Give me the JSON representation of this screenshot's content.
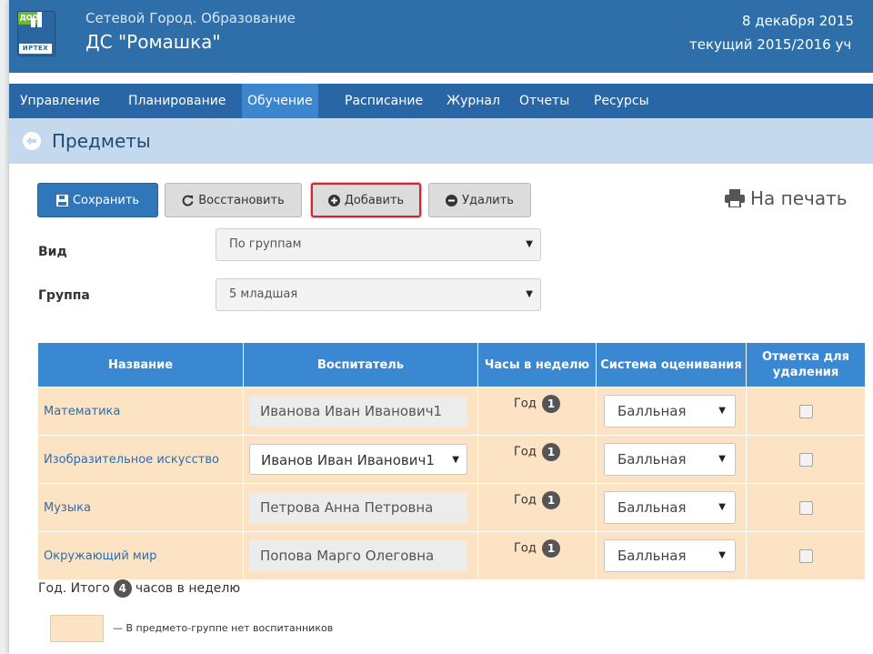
{
  "header": {
    "logo_top": "ДОО",
    "logo_bottom": "ИРТЕХ",
    "app_title": "Сетевой Город. Образование",
    "org_name": "ДС \"Ромашка\"",
    "date": "8 декабря 2015",
    "school_year": "текущий 2015/2016 уч"
  },
  "menu": {
    "items": [
      {
        "label": "Управление"
      },
      {
        "label": "Планирование"
      },
      {
        "label": "Обучение",
        "active": true
      },
      {
        "label": "Расписание"
      },
      {
        "label": "Журнал"
      },
      {
        "label": "Отчеты"
      },
      {
        "label": "Ресурсы"
      }
    ]
  },
  "page": {
    "title": "Предметы"
  },
  "toolbar": {
    "save_label": "Сохранить",
    "restore_label": "Восстановить",
    "add_label": "Добавить",
    "delete_label": "Удалить",
    "print_label": "На печать"
  },
  "filters": {
    "view_label": "Вид",
    "view_value": "По группам",
    "group_label": "Группа",
    "group_value": "5 младшая"
  },
  "table": {
    "headers": [
      "Название",
      "Воспитатель",
      "Часы в неделю",
      "Система оценивания",
      "Отметка для удаления"
    ],
    "rows": [
      {
        "subject": "Математика",
        "teacher": "Иванова Иван Иванович1",
        "teacher_is_select": false,
        "period": "Год",
        "hours": "1",
        "grading": "Балльная",
        "mark": false
      },
      {
        "subject": "Изобразительное искусство",
        "teacher": "Иванов Иван Иванович1",
        "teacher_is_select": true,
        "period": "Год",
        "hours": "1",
        "grading": "Балльная",
        "mark": false
      },
      {
        "subject": "Музыка",
        "teacher": "Петрова Анна Петровна",
        "teacher_is_select": false,
        "period": "Год",
        "hours": "1",
        "grading": "Балльная",
        "mark": false
      },
      {
        "subject": "Окружающий мир",
        "teacher": "Попова Марго Олеговна",
        "teacher_is_select": false,
        "period": "Год",
        "hours": "1",
        "grading": "Балльная",
        "mark": false
      }
    ]
  },
  "summary": {
    "prefix": "Год. Итого",
    "total": "4",
    "suffix": "часов в неделю"
  },
  "legend": {
    "text": "— В предмето-группе нет воспитанников",
    "color": "#fce3c3"
  },
  "colors": {
    "header_bg": "#2e6faa",
    "menu_bg": "#2866a6",
    "menu_active": "#3c86cf",
    "table_header": "#3a87d2",
    "row_bg": "#fce3c3",
    "highlight": "#d6252e"
  }
}
